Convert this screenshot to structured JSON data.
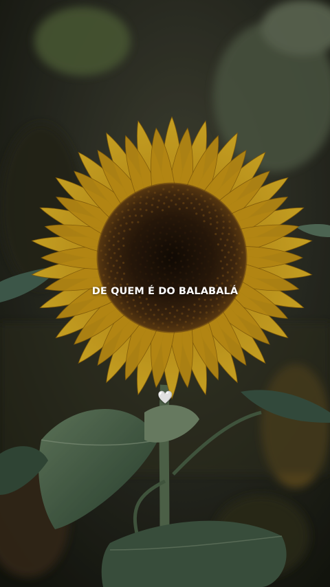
{
  "caption": {
    "text": "DE QUEM É DO BALABALÁ"
  },
  "emoji": {
    "heart": "🤍",
    "icon": "white-heart-icon"
  },
  "colors": {
    "petal": "#e8b61a",
    "petal_shadow": "#b58410",
    "disk": "#3a2410",
    "leaf": "#4f6a4c",
    "background": "#2b2d22",
    "text": "#ffffff"
  }
}
